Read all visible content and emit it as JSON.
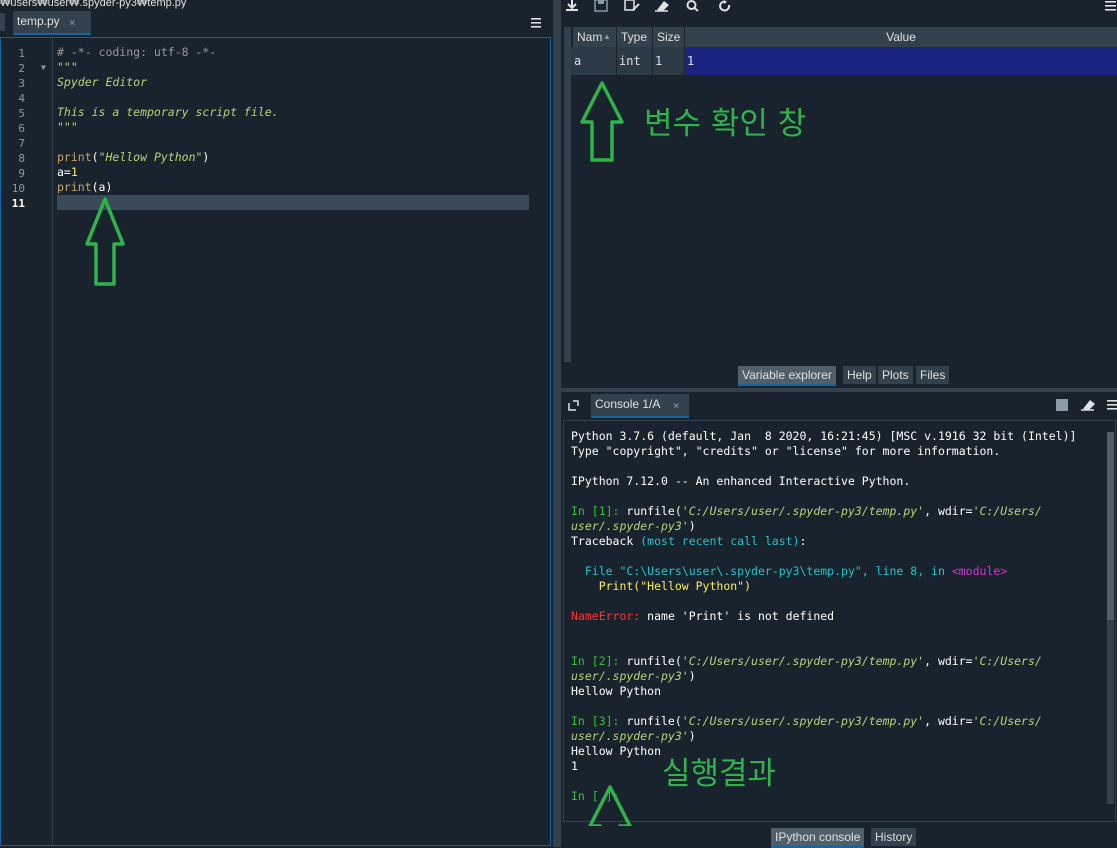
{
  "editor": {
    "path": "₩users₩user₩.spyder-py3₩temp.py",
    "tab_label": "temp.py",
    "tab_close": "×",
    "menu_icon": "hamburger-menu-icon",
    "line_numbers": [
      "1",
      "2",
      "3",
      "4",
      "5",
      "6",
      "7",
      "8",
      "9",
      "10",
      "11"
    ],
    "lines": {
      "l1": "# -*- coding: utf-8 -*-",
      "l2": "\"\"\"",
      "l3": "Spyder Editor",
      "l5": "This is a temporary script file.",
      "l6": "\"\"\"",
      "l8_fn": "print",
      "l8_open": "(",
      "l8_str": "\"Hellow Python\"",
      "l8_close": ")",
      "l9_var": "a=",
      "l9_num": "1",
      "l10_fn": "print",
      "l10_rest": "(a)"
    }
  },
  "variable_explorer": {
    "toolbar_icons": [
      "import-data-icon",
      "save-data-icon",
      "save-as-icon",
      "erase-icon",
      "search-icon",
      "refresh-icon"
    ],
    "headers": {
      "name": "Nam",
      "type": "Type",
      "size": "Size",
      "value": "Value"
    },
    "rows": [
      {
        "name": "a",
        "type": "int",
        "size": "1",
        "value": "1"
      }
    ],
    "annotation": "변수 확인 창",
    "tabs": [
      "Variable explorer",
      "Help",
      "Plots",
      "Files"
    ]
  },
  "console": {
    "tab_label": "Console 1/A",
    "tab_close": "×",
    "lines": {
      "c1": "Python 3.7.6 (default, Jan  8 2020, 16:21:45) [MSC v.1916 32 bit (Intel)]",
      "c2": "Type \"copyright\", \"credits\" or \"license\" for more information.",
      "c3": "IPython 7.12.0 -- An enhanced Interactive Python.",
      "p1": "In [1]: ",
      "run1": "runfile(",
      "path1": "'C:/Users/user/.spyder-py3/temp.py'",
      "wdir": ", wdir=",
      "wdir_val_a": "'C:/Users/",
      "wdir_val_b": "user/.spyder-py3'",
      "close_paren": ")",
      "tb_label": "Traceback ",
      "tb_recent": "(most recent call last)",
      "tb_colon": ":",
      "file_a": "  File ",
      "file_b": "\"C:\\Users\\user\\.spyder-py3\\temp.py\"",
      "file_c": ", line ",
      "file_d": "8",
      "file_e": ", in ",
      "file_f": "<module>",
      "print_err": "    Print(\"Hellow Python\")",
      "err_name": "NameError:",
      "err_msg": " name 'Print' is not defined",
      "p2": "In [2]: ",
      "p3": "In [3]: ",
      "out1": "Hellow Python",
      "out2": "Hellow Python",
      "out3": "1",
      "p4": "In [ ]:"
    },
    "annotation": "실행결과",
    "tabs": [
      "IPython console",
      "History"
    ]
  },
  "colors": {
    "background": "#19232d",
    "accent": "#1464a0",
    "annotation_green": "#2fb34a"
  }
}
